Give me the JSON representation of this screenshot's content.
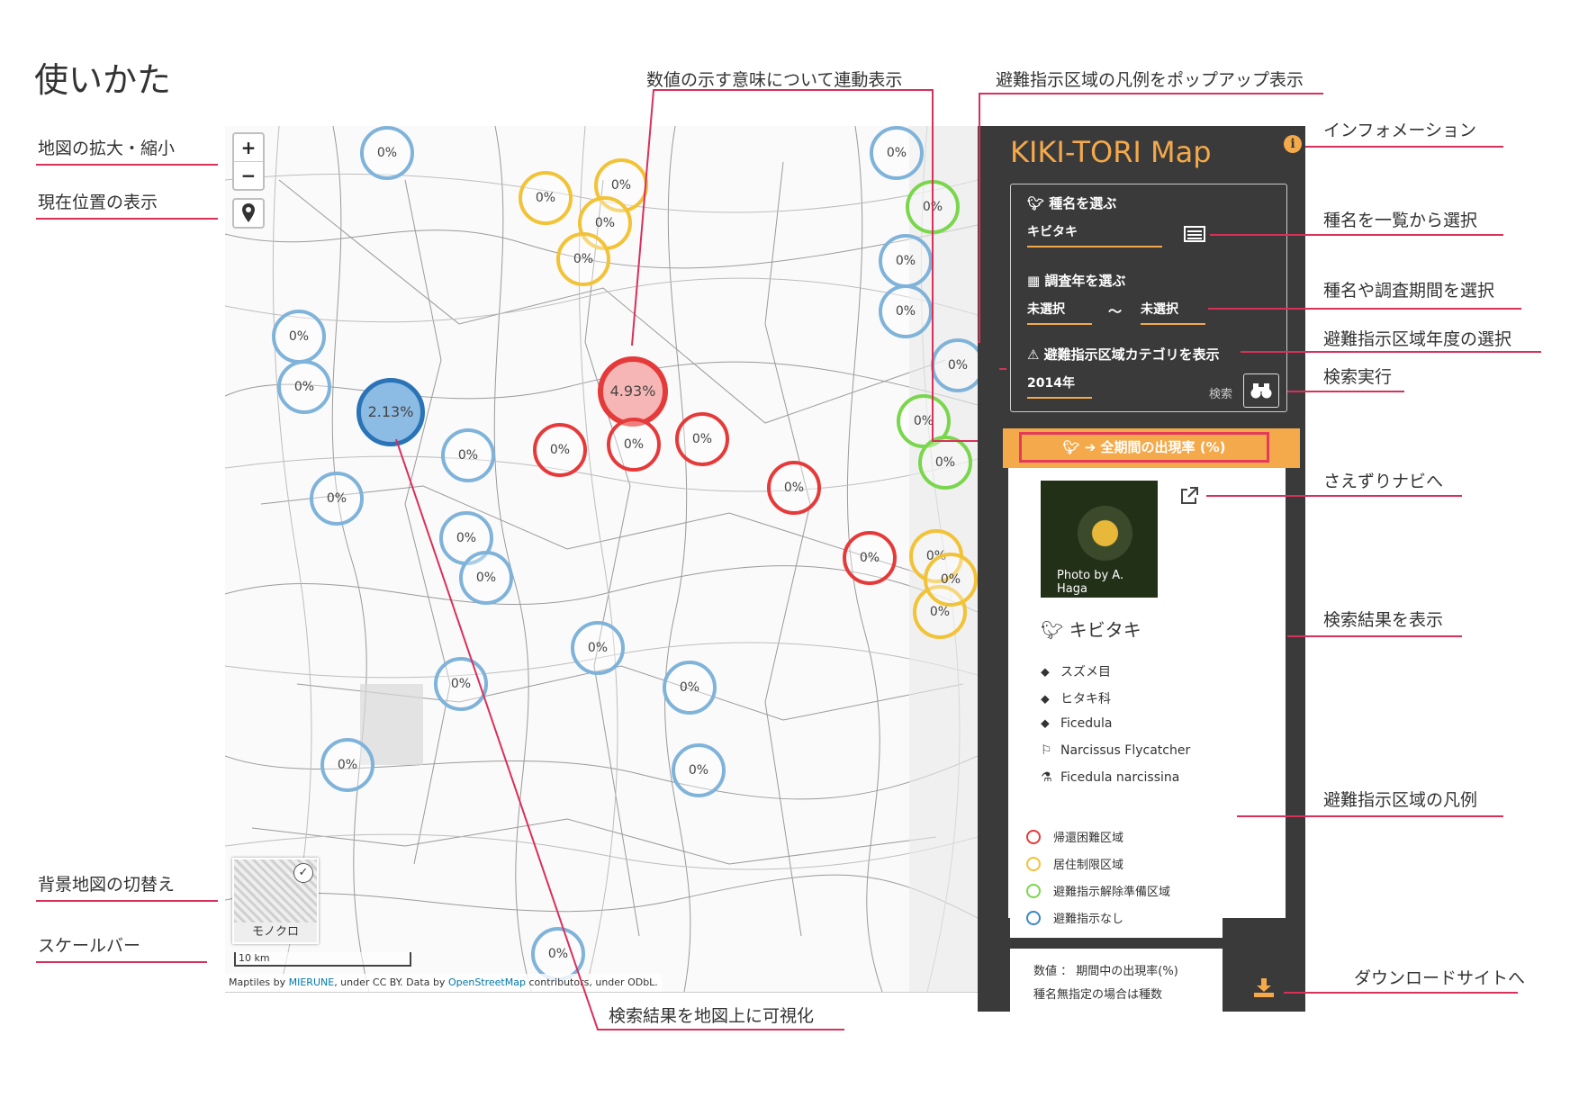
{
  "page": {
    "title": "使いかた"
  },
  "annotations": {
    "zoom": "地図の拡大・縮小",
    "location": "現在位置の表示",
    "basemap_switch": "背景地図の切替え",
    "scalebar": "スケールバー",
    "linked_value": "数値の示す意味について連動表示",
    "legend_popup": "避難指示区域の凡例をポップアップ表示",
    "information": "インフォメーション",
    "select_from_list": "種名を一覧から選択",
    "select_species_period": "種名や調査期間を選択",
    "select_zone_year": "避難指示区域年度の選択",
    "run_search": "検索実行",
    "to_saezuri_navi": "さえずりナビへ",
    "show_results": "検索結果を表示",
    "zone_legend": "避難指示区域の凡例",
    "to_download": "ダウンロードサイトへ",
    "visualize_on_map": "検索結果を地図上に可視化"
  },
  "map": {
    "zoom_in": "+",
    "zoom_out": "−",
    "layer_label": "モノクロ",
    "scale_label": "10 km",
    "attribution": {
      "prefix": "Maptiles by ",
      "link1": "MIERUNE",
      "mid": ", under CC BY. Data by ",
      "link2": "OpenStreetMap",
      "suffix": " contributors, under ODbL."
    },
    "markers": [
      {
        "label": "0%",
        "color": "blue"
      },
      {
        "label": "0%",
        "color": "blue"
      },
      {
        "label": "0%",
        "color": "blue"
      },
      {
        "label": "0%",
        "color": "blue"
      },
      {
        "label": "2.13%",
        "color": "blue",
        "emphasis": true
      },
      {
        "label": "0%",
        "color": "yellow"
      },
      {
        "label": "0%",
        "color": "yellow"
      },
      {
        "label": "0%",
        "color": "yellow"
      },
      {
        "label": "0%",
        "color": "yellow"
      },
      {
        "label": "4.93%",
        "color": "red",
        "emphasis": true
      },
      {
        "label": "0%",
        "color": "red"
      },
      {
        "label": "0%",
        "color": "red"
      },
      {
        "label": "0%",
        "color": "red"
      },
      {
        "label": "0%",
        "color": "red"
      },
      {
        "label": "0%",
        "color": "red"
      },
      {
        "label": "0%",
        "color": "blue"
      },
      {
        "label": "0%",
        "color": "blue"
      },
      {
        "label": "0%",
        "color": "blue"
      },
      {
        "label": "0%",
        "color": "blue"
      },
      {
        "label": "0%",
        "color": "blue"
      },
      {
        "label": "0%",
        "color": "blue"
      },
      {
        "label": "0%",
        "color": "blue"
      },
      {
        "label": "0%",
        "color": "blue"
      },
      {
        "label": "0%",
        "color": "blue"
      },
      {
        "label": "0%",
        "color": "blue"
      },
      {
        "label": "0%",
        "color": "blue"
      },
      {
        "label": "0%",
        "color": "blue"
      },
      {
        "label": "0%",
        "color": "blue"
      },
      {
        "label": "0%",
        "color": "green"
      },
      {
        "label": "0%",
        "color": "green"
      },
      {
        "label": "0%",
        "color": "yellow"
      },
      {
        "label": "0%",
        "color": "yellow"
      },
      {
        "label": "0%",
        "color": "yellow"
      },
      {
        "label": "0%",
        "color": "green"
      }
    ]
  },
  "panel": {
    "app_title": "KIKI-TORI  Map",
    "species_label": "種名を選ぶ",
    "species_value": "キビタキ",
    "year_label": "調査年を選ぶ",
    "year_from": "未選択",
    "year_sep": "〜",
    "year_to": "未選択",
    "zone_label": "避難指示区域カテゴリを表示",
    "zone_year": "2014年",
    "search_label": "検索",
    "rate_label": "全期間の出現率 (%)",
    "photo_credit": "Photo by A. Haga",
    "result": {
      "name": "キビタキ",
      "order": "スズメ目",
      "family": "ヒタキ科",
      "genus": "Ficedula",
      "english": "Narcissus  Flycatcher",
      "scientific": "Ficedula  narcissina"
    },
    "legend": [
      {
        "label": "帰還困難区域",
        "color": "#e53a3a"
      },
      {
        "label": "居住制限区域",
        "color": "#f2c237"
      },
      {
        "label": "避難指示解除準備区域",
        "color": "#7ad64c"
      },
      {
        "label": "避難指示なし",
        "color": "#3c86c8"
      }
    ],
    "note_line1": "数値 ： 期間中の出現率(%)",
    "note_line2": "種名無指定の場合は種数"
  },
  "colors": {
    "accent": "#f4a94a",
    "panel_bg": "#3a3a3a",
    "annotation_line": "#d9305a"
  }
}
